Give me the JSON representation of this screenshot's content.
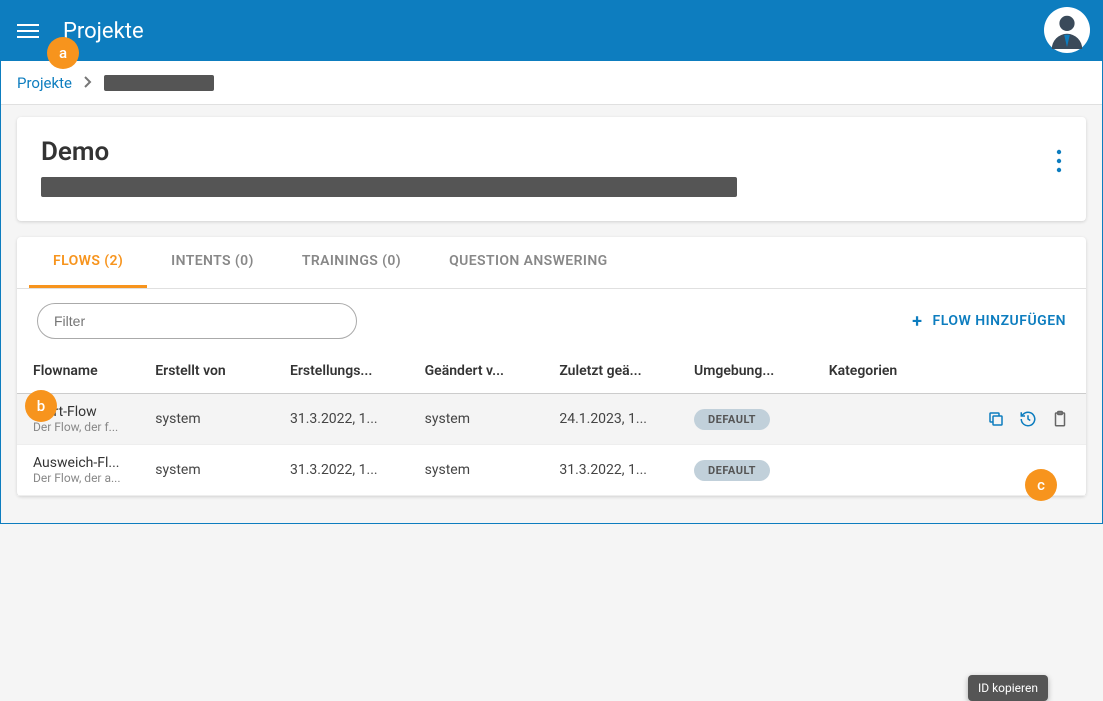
{
  "header": {
    "title": "Projekte"
  },
  "breadcrumb": {
    "root": "Projekte"
  },
  "project": {
    "title": "Demo"
  },
  "more_menu": {
    "tooltip_id_copy": "ID kopieren"
  },
  "tabs": [
    {
      "label": "FLOWS (2)",
      "active": true
    },
    {
      "label": "INTENTS (0)",
      "active": false
    },
    {
      "label": "TRAININGS (0)",
      "active": false
    },
    {
      "label": "QUESTION ANSWERING",
      "active": false
    }
  ],
  "filter": {
    "placeholder": "Filter"
  },
  "actions": {
    "add_flow": "FLOW HINZUFÜGEN"
  },
  "table": {
    "headers": {
      "flowname": "Flowname",
      "createdby": "Erstellt von",
      "createdat": "Erstellungs...",
      "changedby": "Geändert v...",
      "changedat": "Zuletzt geä...",
      "envs": "Umgebung...",
      "categories": "Kategorien"
    },
    "rows": [
      {
        "name": "Start-Flow",
        "subtitle": "Der Flow, der f...",
        "createdby": "system",
        "createdat": "31.3.2022, 1...",
        "changedby": "system",
        "changedat": "24.1.2023, 1...",
        "env": "DEFAULT",
        "show_actions": true
      },
      {
        "name": "Ausweich-Fl...",
        "subtitle": "Der Flow, der a...",
        "createdby": "system",
        "createdat": "31.3.2022, 1...",
        "changedby": "system",
        "changedat": "31.3.2022, 1...",
        "env": "DEFAULT",
        "show_actions": false
      }
    ]
  },
  "badges": {
    "a": "a",
    "b": "b",
    "c": "c"
  }
}
